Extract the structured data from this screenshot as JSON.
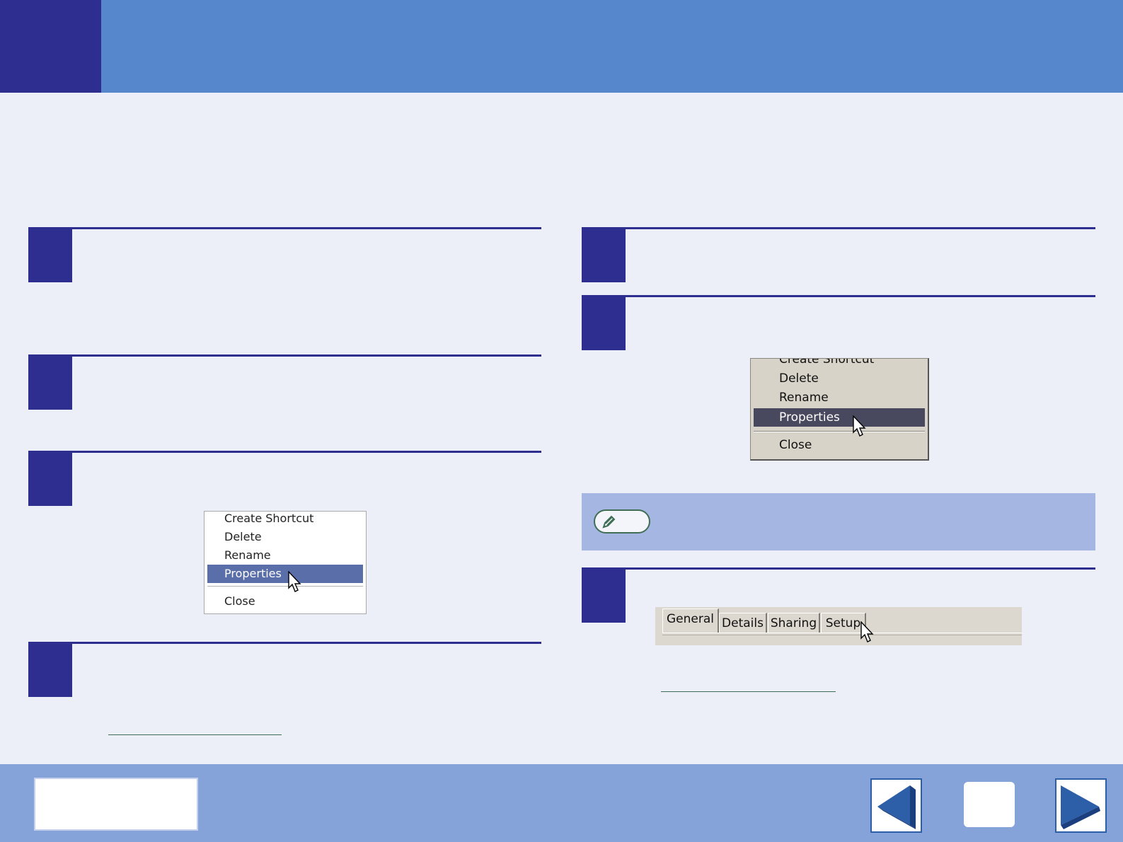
{
  "left_menu": {
    "items": [
      "Create Shortcut",
      "Delete",
      "Rename",
      "Properties",
      "Close"
    ],
    "selected": "Properties"
  },
  "right_menu": {
    "items": [
      "Create Shortcut",
      "Delete",
      "Rename",
      "Properties",
      "Close"
    ],
    "selected": "Properties"
  },
  "tabs": [
    "General",
    "Details",
    "Sharing",
    "Setup"
  ],
  "colors": {
    "header": "#5686cb",
    "accent": "#2d2e8f",
    "background": "#eceff8",
    "footer": "#86a3d9",
    "note_bar": "#a6b6e2"
  },
  "icons": {
    "note": "pencil-icon",
    "prev": "arrow-left-icon",
    "next": "arrow-right-icon",
    "cursor": "mouse-pointer-icon"
  }
}
